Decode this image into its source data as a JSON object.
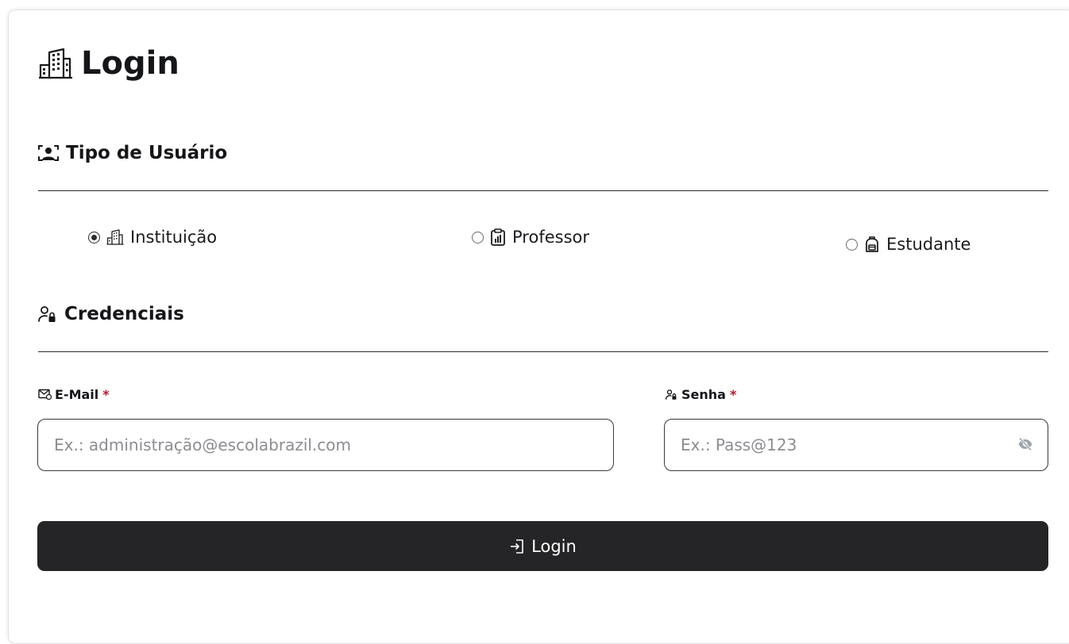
{
  "page": {
    "title": "Login"
  },
  "user_type": {
    "heading": "Tipo de Usuário",
    "selected": "Instituição",
    "options": [
      {
        "label": "Instituição",
        "icon": "building-icon",
        "checked": true
      },
      {
        "label": "Professor",
        "icon": "clipboard-icon",
        "checked": false
      },
      {
        "label": "Estudante",
        "icon": "backpack-icon",
        "checked": false
      }
    ]
  },
  "credentials": {
    "heading": "Credenciais",
    "email": {
      "label": "E-Mail",
      "required_mark": "*",
      "value": "",
      "placeholder": "Ex.: administração@escolabrazil.com"
    },
    "password": {
      "label": "Senha",
      "required_mark": "*",
      "value": "",
      "placeholder": "Ex.: Pass@123"
    }
  },
  "actions": {
    "login_label": "Login"
  },
  "colors": {
    "button_bg": "#252527",
    "required": "#c0142a",
    "text": "#151619"
  }
}
